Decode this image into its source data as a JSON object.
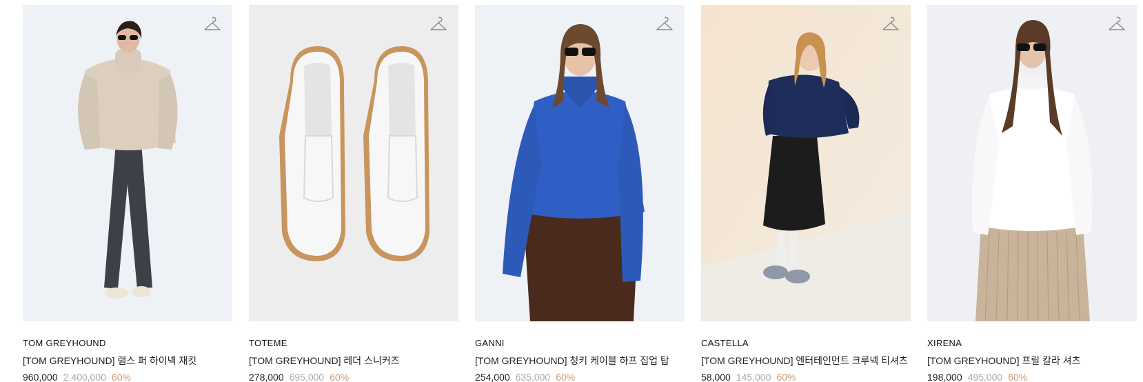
{
  "products": [
    {
      "brand": "TOM GREYHOUND",
      "name": "[TOM GREYHOUND] 램스 퍼 하이넥 재킷",
      "price": "960,000",
      "original_price": "2,400,000",
      "discount": "60%",
      "image": "woman-in-beige-lamb-fur-jacket",
      "bg": "#eef2f7"
    },
    {
      "brand": "TOTEME",
      "name": "[TOM GREYHOUND] 레더 스니커즈",
      "price": "278,000",
      "original_price": "695,000",
      "discount": "60%",
      "image": "white-leather-sneakers",
      "bg": "#ededed"
    },
    {
      "brand": "GANNI",
      "name": "[TOM GREYHOUND] 청키 케이블 하프 집업 탑",
      "price": "254,000",
      "original_price": "635,000",
      "discount": "60%",
      "image": "woman-in-blue-cable-knit-zip-top",
      "bg": "#eef1f5"
    },
    {
      "brand": "CASTELLA",
      "name": "[TOM GREYHOUND] 엔터테인먼트 크루넥 티셔츠",
      "price": "58,000",
      "original_price": "145,000",
      "discount": "60%",
      "image": "woman-in-navy-sweatshirt-and-sequin-skirt",
      "bg": "#f3e6d4"
    },
    {
      "brand": "XIRENA",
      "name": "[TOM GREYHOUND] 프릴 칼라 셔츠",
      "price": "198,000",
      "original_price": "495,000",
      "discount": "60%",
      "image": "woman-in-white-frill-collar-shirt",
      "bg": "#eef0f4"
    }
  ],
  "colors": {
    "discount": "#c79a74",
    "original_price": "#a8a8a8",
    "text": "#222222"
  },
  "icons": {
    "wishlist": "hanger-icon"
  }
}
